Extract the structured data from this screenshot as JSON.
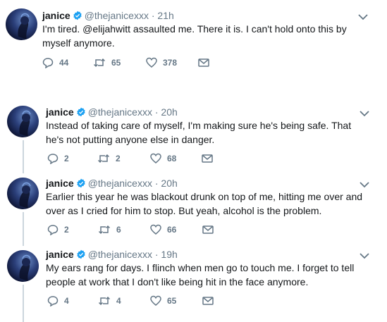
{
  "tweets": [
    {
      "name": "janice",
      "handle": "@thejanicexxx",
      "time": "· 21h",
      "text": "I'm tired. @elijahwitt assaulted me. There it is. I can't hold onto this by myself anymore.",
      "replies": "44",
      "retweets": "65",
      "likes": "378"
    },
    {
      "name": "janice",
      "handle": "@thejanicexxx",
      "time": "· 20h",
      "text": "Instead of taking care of myself, I'm making sure he's being safe. That he's not putting anyone else in danger.",
      "replies": "2",
      "retweets": "2",
      "likes": "68"
    },
    {
      "name": "janice",
      "handle": "@thejanicexxx",
      "time": "· 20h",
      "text": "Earlier this year he was blackout drunk on top of me, hitting me over and over as I cried for him to stop. But yeah, alcohol is the problem.",
      "replies": "2",
      "retweets": "6",
      "likes": "66"
    },
    {
      "name": "janice",
      "handle": "@thejanicexxx",
      "time": "· 19h",
      "text": "My ears rang for days. I flinch when men go to touch me. I forget to tell people at work that I don't like being hit in the face anymore.",
      "replies": "4",
      "retweets": "4",
      "likes": "65"
    }
  ],
  "colors": {
    "text": "#14171a",
    "muted": "#657786",
    "verified": "#1da1f2",
    "thread_line": "#ccd6dd"
  }
}
